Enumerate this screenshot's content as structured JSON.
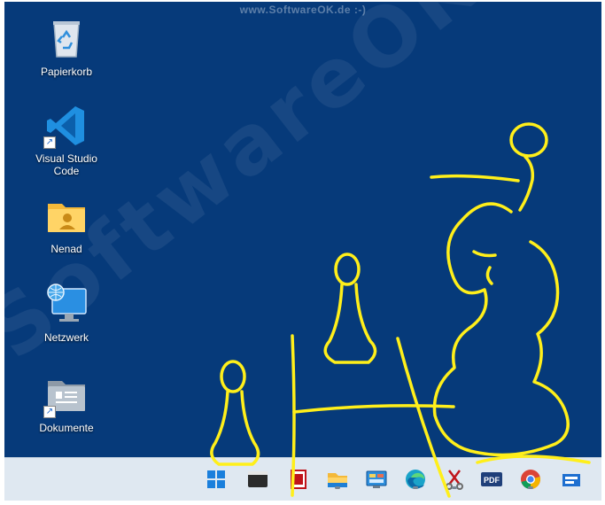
{
  "watermark_top": "www.SoftwareOK.de :-)",
  "watermark_diagonal": "SoftwareOK.com",
  "desktop_icons": [
    {
      "label": "Papierkorb",
      "icon": "recycle-bin-icon"
    },
    {
      "label": "Visual Studio Code",
      "icon": "vscode-icon"
    },
    {
      "label": "Nenad",
      "icon": "user-folder-icon"
    },
    {
      "label": "Netzwerk",
      "icon": "network-icon"
    },
    {
      "label": "Dokumente",
      "icon": "documents-icon"
    }
  ],
  "taskbar_items": [
    {
      "name": "start-button",
      "icon": "windows-logo-icon"
    },
    {
      "name": "terminal-button",
      "icon": "terminal-icon"
    },
    {
      "name": "app-red-button",
      "icon": "red-app-icon"
    },
    {
      "name": "file-explorer-button",
      "icon": "folder-icon"
    },
    {
      "name": "control-panel-button",
      "icon": "control-panel-icon"
    },
    {
      "name": "edge-button",
      "icon": "edge-icon"
    },
    {
      "name": "tools-button",
      "icon": "scissors-icon"
    },
    {
      "name": "pdf-button",
      "icon": "pdf-icon"
    },
    {
      "name": "chrome-button",
      "icon": "chrome-icon"
    },
    {
      "name": "app-more-button",
      "icon": "app-icon"
    }
  ],
  "colors": {
    "desktop": "#063a7a",
    "taskbar": "#dfe8f1",
    "drawing": "#ffef1a"
  }
}
